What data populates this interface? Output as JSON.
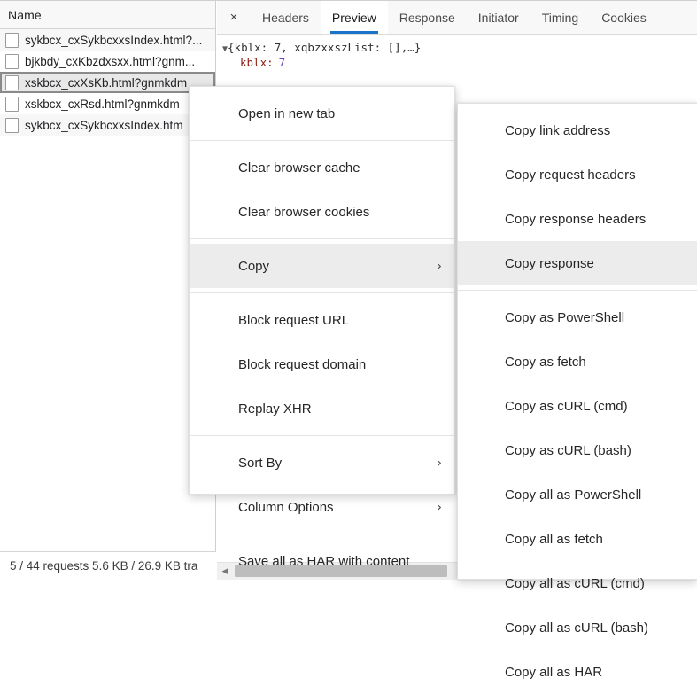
{
  "requests_panel": {
    "column_header": "Name",
    "rows": [
      {
        "label": "sykbcx_cxSykbcxxsIndex.html?...",
        "selected": false
      },
      {
        "label": "bjkbdy_cxKbzdxsxx.html?gnm...",
        "selected": false
      },
      {
        "label": "xskbcx_cxXsKb.html?gnmkdm",
        "selected": true
      },
      {
        "label": "xskbcx_cxRsd.html?gnmkdm",
        "selected": false
      },
      {
        "label": "sykbcx_cxSykbcxxsIndex.htm",
        "selected": false
      }
    ],
    "status_text": "5 / 44 requests  5.6 KB / 26.9 KB tra"
  },
  "detail_panel": {
    "close_label": "×",
    "tabs": [
      {
        "label": "Headers",
        "active": false
      },
      {
        "label": "Preview",
        "active": true
      },
      {
        "label": "Response",
        "active": false
      },
      {
        "label": "Initiator",
        "active": false
      },
      {
        "label": "Timing",
        "active": false
      },
      {
        "label": "Cookies",
        "active": false
      }
    ],
    "preview": {
      "triangle": "▼",
      "root_line": "{kblx: 7, xqbzxxszList: [],…}",
      "child_key": "kblx:",
      "child_value": "7"
    },
    "accent_color": "#1a73c8"
  },
  "context_menu": {
    "items": [
      {
        "label": "Open in new tab",
        "has_submenu": false,
        "highlighted": false
      },
      {
        "separator": true
      },
      {
        "label": "Clear browser cache",
        "has_submenu": false,
        "highlighted": false
      },
      {
        "label": "Clear browser cookies",
        "has_submenu": false,
        "highlighted": false
      },
      {
        "separator": true
      },
      {
        "label": "Copy",
        "has_submenu": true,
        "highlighted": true
      },
      {
        "separator": true
      },
      {
        "label": "Block request URL",
        "has_submenu": false,
        "highlighted": false
      },
      {
        "label": "Block request domain",
        "has_submenu": false,
        "highlighted": false
      },
      {
        "label": "Replay XHR",
        "has_submenu": false,
        "highlighted": false
      },
      {
        "separator": true
      },
      {
        "label": "Sort By",
        "has_submenu": true,
        "highlighted": false
      },
      {
        "label": "Column Options",
        "has_submenu": true,
        "highlighted": false
      },
      {
        "separator": true
      },
      {
        "label": "Save all as HAR with content",
        "has_submenu": false,
        "highlighted": false
      }
    ],
    "submenu_arrow": "›"
  },
  "copy_submenu": {
    "items": [
      {
        "label": "Copy link address",
        "highlighted": false
      },
      {
        "label": "Copy request headers",
        "highlighted": false
      },
      {
        "label": "Copy response headers",
        "highlighted": false
      },
      {
        "label": "Copy response",
        "highlighted": true
      },
      {
        "separator": true
      },
      {
        "label": "Copy as PowerShell",
        "highlighted": false
      },
      {
        "label": "Copy as fetch",
        "highlighted": false
      },
      {
        "label": "Copy as cURL (cmd)",
        "highlighted": false
      },
      {
        "label": "Copy as cURL (bash)",
        "highlighted": false
      },
      {
        "label": "Copy all as PowerShell",
        "highlighted": false
      },
      {
        "label": "Copy all as fetch",
        "highlighted": false
      },
      {
        "label": "Copy all as cURL (cmd)",
        "highlighted": false
      },
      {
        "label": "Copy all as cURL (bash)",
        "highlighted": false
      },
      {
        "label": "Copy all as HAR",
        "highlighted": false
      }
    ]
  },
  "scrollbar": {
    "left_arrow": "◀"
  }
}
